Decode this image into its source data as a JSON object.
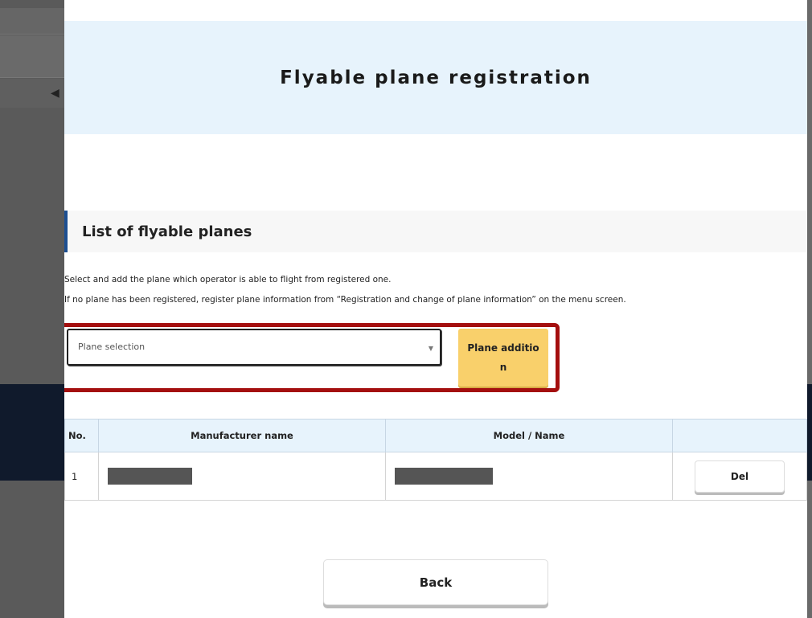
{
  "modal": {
    "title": "Flyable plane registration"
  },
  "section": {
    "title": "List of flyable planes",
    "description_1": "Select and add the plane which operator is able to flight from registered one.",
    "description_2": "If no plane has been registered, register plane information from “Registration and change of plane information” on the menu screen."
  },
  "plane_select": {
    "placeholder": "Plane selection",
    "arrow": "▼"
  },
  "add_button": {
    "label": "Plane addition"
  },
  "table": {
    "headers": [
      "No.",
      "Manufacturer name",
      "Model / Name",
      ""
    ],
    "rows": [
      {
        "no": "1",
        "manufacturer": "",
        "model": "",
        "action": "Del"
      }
    ]
  },
  "back_button": {
    "label": "Back"
  },
  "colors": {
    "header_bg": "#e7f3fc",
    "accent_yellow": "#f9d06b",
    "highlight_red": "#a40f0f",
    "section_bar": "#1d4f91"
  }
}
